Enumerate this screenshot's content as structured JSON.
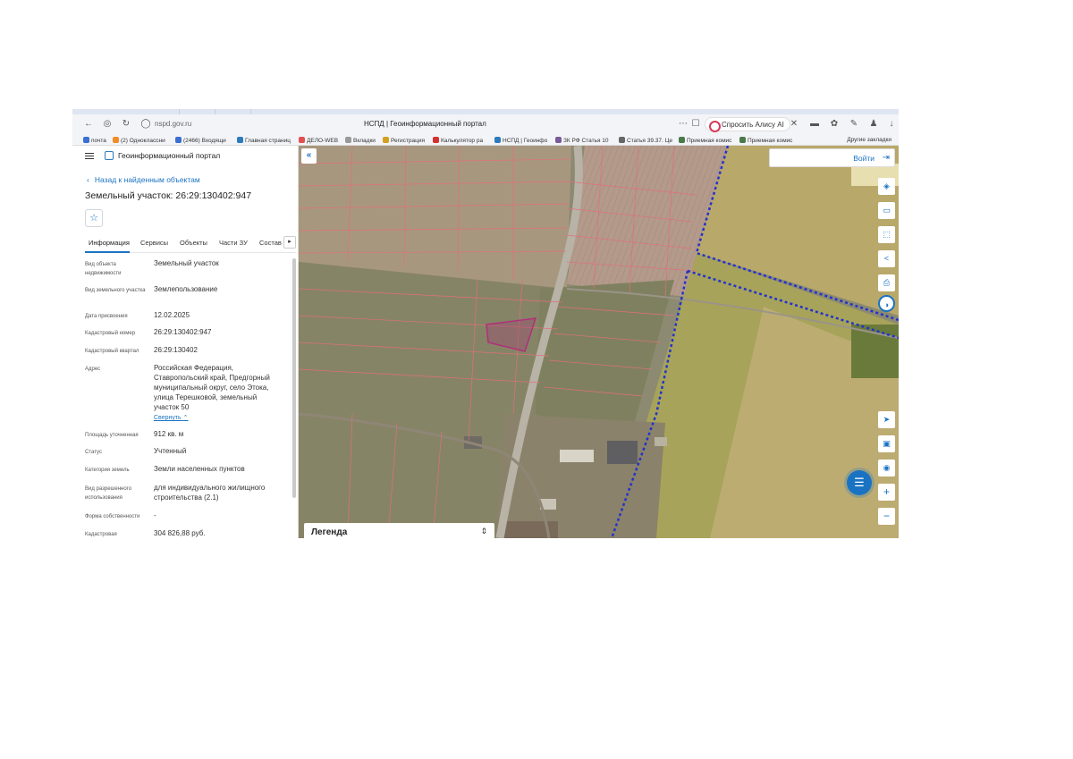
{
  "browser": {
    "url": "nspd.gov.ru",
    "page_title": "НСПД | Геоинформационный портал",
    "alice_button": "Спросить Алису AI",
    "bookmarks": [
      {
        "label": "почта",
        "color": "#3b6fd1"
      },
      {
        "label": "(2) Одноклассни",
        "color": "#f28c28"
      },
      {
        "label": "(2466) Входящи",
        "color": "#3b6fd1"
      },
      {
        "label": "Главная страниц",
        "color": "#2b7bbd"
      },
      {
        "label": "ДЕЛО-WEB",
        "color": "#e05050"
      },
      {
        "label": "Вкладки",
        "color": "#999999"
      },
      {
        "label": "Регистрация",
        "color": "#d4a020"
      },
      {
        "label": "Калькулятор ра",
        "color": "#d43030"
      },
      {
        "label": "НСПД | Геоинфо",
        "color": "#2b7bbd"
      },
      {
        "label": "ЗК РФ Статья 10",
        "color": "#7a5a9a"
      },
      {
        "label": "Статья 39.37. Це",
        "color": "#666666"
      },
      {
        "label": "Приемная комис",
        "color": "#4a7a4a"
      },
      {
        "label": "Приемная комис",
        "color": "#4a7a4a"
      }
    ],
    "other_bookmarks": "Другие закладки"
  },
  "panel": {
    "portal_name": "Геоинформационный портал",
    "back_link": "Назад к найденным объектам",
    "title": "Земельный участок: 26:29:130402:947",
    "tabs": [
      {
        "label": "Информация"
      },
      {
        "label": "Сервисы"
      },
      {
        "label": "Объекты"
      },
      {
        "label": "Части ЗУ"
      },
      {
        "label": "Состав"
      }
    ],
    "properties": [
      {
        "key": "Вид объекта недвижимости",
        "value": "Земельный участок"
      },
      {
        "key": "Вид земельного участка",
        "value": "Землепользование"
      },
      {
        "key": "Дата присвоения",
        "value": "12.02.2025"
      },
      {
        "key": "Кадастровый номер",
        "value": "26:29:130402:947"
      },
      {
        "key": "Кадастровый квартал",
        "value": "26:29:130402"
      },
      {
        "key": "Адрес",
        "value": "Российская Федерация, Ставропольский край, Предгорный муниципальный округ, село Этока, улица Терешковой, земельный участок 50"
      },
      {
        "key": "Площадь уточненная",
        "value": "912 кв. м"
      },
      {
        "key": "Статус",
        "value": "Учтенный"
      },
      {
        "key": "Категория земель",
        "value": "Земли населенных пунктов"
      },
      {
        "key": "Вид разрешенного использования",
        "value": "для индивидуального жилищного строительства (2.1)"
      },
      {
        "key": "Форма собственности",
        "value": "-"
      },
      {
        "key": "Кадастровая",
        "value": "304 826,88 руб."
      }
    ],
    "collapse_link": "Свернуть"
  },
  "map": {
    "login_label": "Войти",
    "legend_label": "Легенда",
    "colors": {
      "parcel_border": "#e0707a",
      "selected_parcel": "#b0307a",
      "zone_border": "#2233cc",
      "accent": "#1a73c2"
    }
  }
}
